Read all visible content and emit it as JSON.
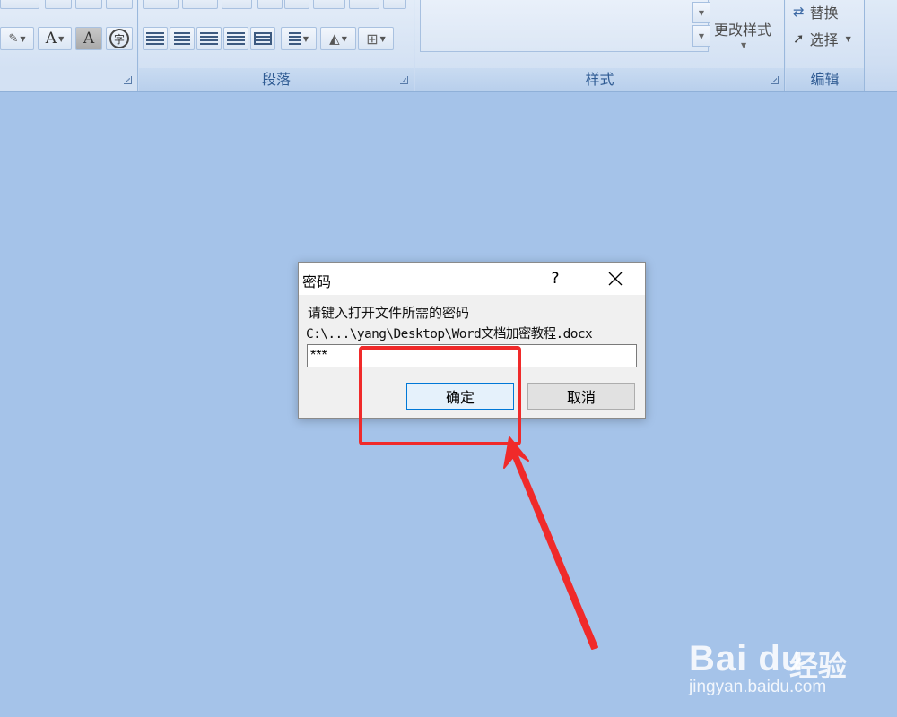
{
  "ribbon": {
    "groups": {
      "paragraph": "段落",
      "styles": "样式",
      "editing": "编辑"
    },
    "change_styles": "更改样式",
    "replace": "替换",
    "select": "选择",
    "font_color_glyph": "A",
    "char_shading_glyph": "A",
    "enclose_char_glyph": "字"
  },
  "dialog": {
    "title": "密码",
    "help": "?",
    "prompt": "请键入打开文件所需的密码",
    "file_path": "C:\\...\\yang\\Desktop\\Word文档加密教程.docx",
    "password_value": "***",
    "ok_label": "确定",
    "cancel_label": "取消"
  },
  "watermark": {
    "brand": "Bai du",
    "suffix": "经验",
    "url": "jingyan.baidu.com"
  },
  "colors": {
    "background": "#a5c3e9",
    "annotation": "#f02a2a",
    "ok_border": "#0078d7"
  }
}
